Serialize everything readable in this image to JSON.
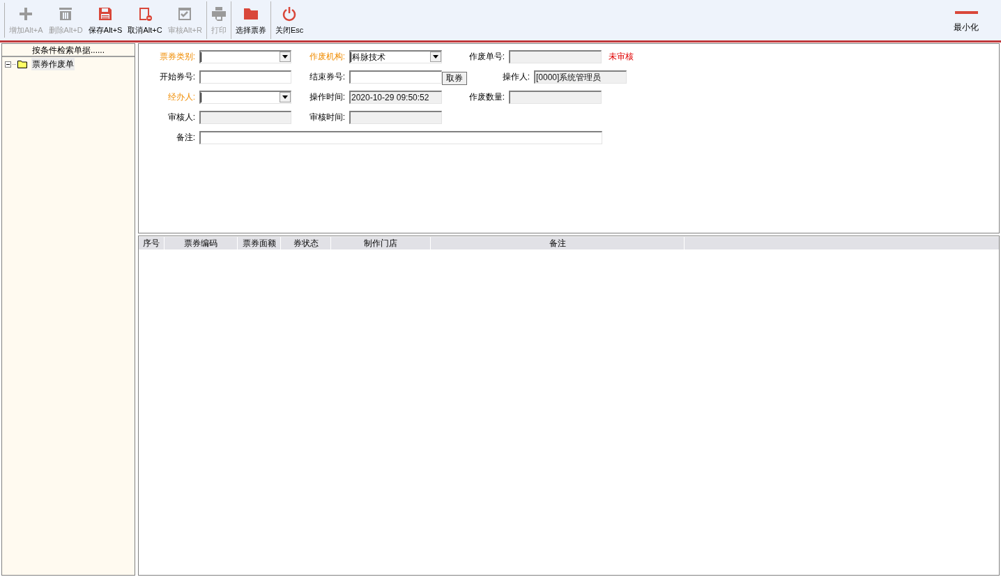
{
  "toolbar": {
    "groups": [
      [
        {
          "kind": "plus",
          "label": "增加Alt+A",
          "disabled": true
        },
        {
          "kind": "trash",
          "label": "删除Alt+D",
          "disabled": true
        },
        {
          "kind": "save",
          "label": "保存Alt+S",
          "disabled": false
        },
        {
          "kind": "cancel",
          "label": "取消Alt+C",
          "disabled": false
        },
        {
          "kind": "audit",
          "label": "审核Alt+R",
          "disabled": true
        }
      ],
      [
        {
          "kind": "print",
          "label": "打印",
          "disabled": true
        }
      ],
      [
        {
          "kind": "folder",
          "label": "选择票券",
          "disabled": false
        }
      ],
      [
        {
          "kind": "power",
          "label": "关闭Esc",
          "disabled": false
        }
      ]
    ],
    "minimize": {
      "label": "最小化"
    }
  },
  "sidebar": {
    "header": "按条件检索单据......",
    "tree": [
      {
        "label": "票券作废单",
        "expanded": true,
        "selected": true
      }
    ]
  },
  "form": {
    "status": "未审核",
    "rows": [
      [
        {
          "label": "票券类别:",
          "required": true,
          "kind": "dropdown"
        },
        {
          "label": "作废机构:",
          "required": true,
          "kind": "dropdown",
          "value": "科脉技术"
        },
        {
          "label": "作废单号:",
          "required": false,
          "kind": "readonly"
        }
      ],
      [
        {
          "label": "开始券号:",
          "required": false,
          "kind": "input"
        },
        {
          "label": "结束券号:",
          "required": false,
          "kind": "input",
          "button": "取券"
        },
        {
          "label": "操作人:",
          "required": false,
          "kind": "readonly",
          "value": "[0000]系统管理员"
        }
      ],
      [
        {
          "label": "经办人:",
          "required": true,
          "kind": "dropdown"
        },
        {
          "label": "操作时间:",
          "required": false,
          "kind": "readonly",
          "value": "2020-10-29 09:50:52"
        },
        {
          "label": "作废数量:",
          "required": false,
          "kind": "readonly"
        }
      ],
      [
        {
          "label": "审核人:",
          "required": false,
          "kind": "readonly"
        },
        {
          "label": "审核时间:",
          "required": false,
          "kind": "readonly"
        }
      ]
    ],
    "note": {
      "label": "备注:",
      "required": false
    }
  },
  "table": {
    "columns": [
      "序号",
      "票券编码",
      "票券面额",
      "券状态",
      "制作门店",
      "备注"
    ]
  }
}
